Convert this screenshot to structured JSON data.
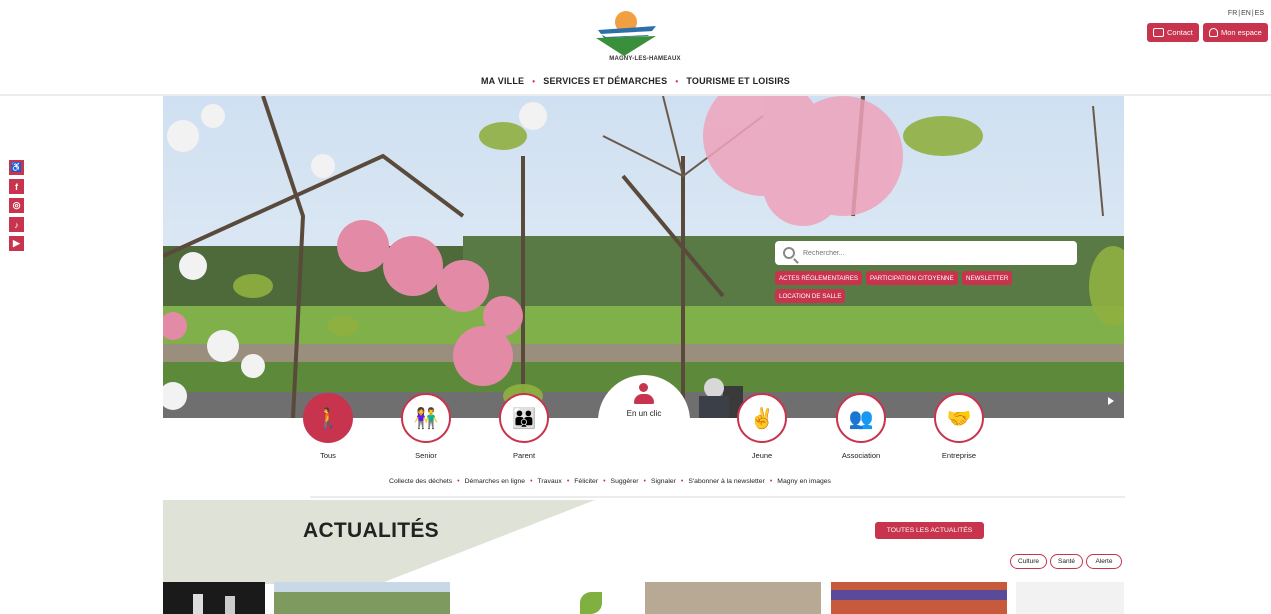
{
  "header": {
    "logo_text": "MAGNY-LES-HAMEAUX",
    "languages": [
      "FR",
      "EN",
      "ES"
    ],
    "contact_label": "Contact",
    "espace_label": "Mon espace",
    "nav": [
      "MA VILLE",
      "SERVICES ET DÉMARCHES",
      "TOURISME ET LOISIRS"
    ]
  },
  "social_icons": [
    "accessibility-icon",
    "facebook-icon",
    "instagram-icon",
    "tiktok-icon",
    "youtube-icon"
  ],
  "search": {
    "placeholder": "Rechercher..."
  },
  "tags": [
    "ACTES RÉGLEMENTAIRES",
    "PARTICIPATION CITOYENNE",
    "NEWSLETTER",
    "LOCATION DE SALLE"
  ],
  "profiles": {
    "tous": "Tous",
    "senior": "Senior",
    "parent": "Parent",
    "en_un_clic": "En un clic",
    "jeune": "Jeune",
    "association": "Association",
    "entreprise": "Entreprise"
  },
  "quick_links": [
    "Collecte des déchets",
    "Démarches en ligne",
    "Travaux",
    "Féliciter",
    "Suggérer",
    "Signaler",
    "S'abonner à la newsletter",
    "Magny en images"
  ],
  "news": {
    "title": "ACTUALITÉS",
    "all_label": "TOUTES LES ACTUALITÉS",
    "filters": [
      "Culture",
      "Santé",
      "Alerte"
    ]
  },
  "colors": {
    "accent": "#c8344d",
    "news_band": "#dfe2d6"
  }
}
